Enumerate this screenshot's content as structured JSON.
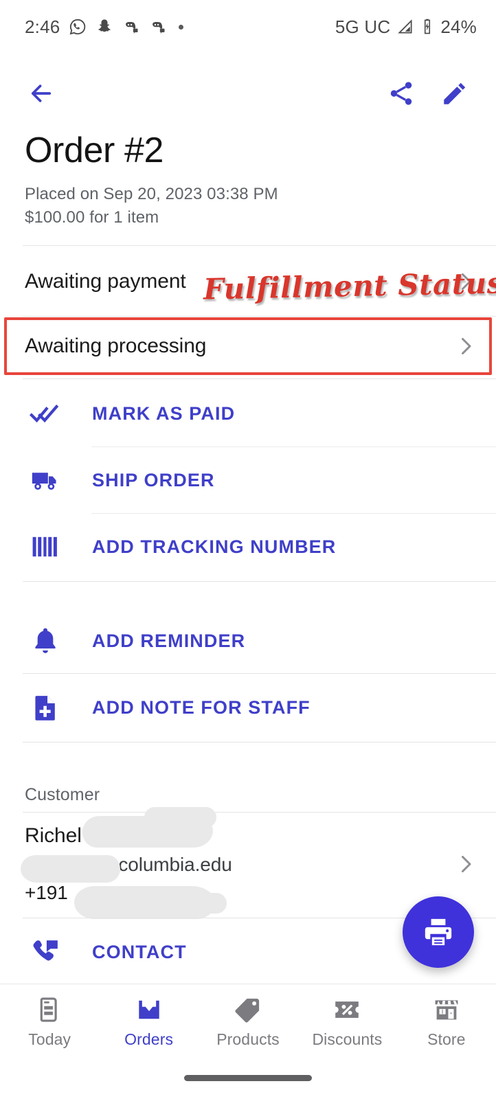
{
  "theme": {
    "accent": "#3f3fc9",
    "fab": "#3f32db",
    "annotation_red": "#d9362c",
    "highlight_red": "#e8453c",
    "text_primary": "#1b1b1b",
    "text_secondary": "#5f6368",
    "divider": "#e4e4e6"
  },
  "statusbar": {
    "time": "2:46",
    "icons": [
      "whatsapp-icon",
      "snapchat-icon",
      "discord-icon",
      "discord-icon",
      "dot-icon"
    ],
    "network": "5G UC",
    "signal_icon": "signal-triangle-icon",
    "battery_icon": "battery-charging-icon",
    "battery": "24%"
  },
  "appbar": {
    "back_icon": "back-arrow-icon",
    "share_icon": "share-icon",
    "edit_icon": "edit-pencil-icon"
  },
  "order": {
    "title": "Order #2",
    "placed": "Placed on Sep 20, 2023 03:38 PM",
    "total": "$100.00 for 1 item"
  },
  "status_rows": [
    {
      "label": "Awaiting payment",
      "chevron_icon": "chevron-right-icon"
    },
    {
      "label": "Awaiting processing",
      "chevron_icon": "chevron-right-icon"
    }
  ],
  "annotation": {
    "text": "Fulfillment Status"
  },
  "actions": [
    {
      "label": "MARK AS PAID",
      "icon": "done-all-icon"
    },
    {
      "label": "SHIP ORDER",
      "icon": "local-shipping-truck-icon"
    },
    {
      "label": "ADD TRACKING NUMBER",
      "icon": "barcode-icon"
    },
    {
      "label": "ADD REMINDER",
      "icon": "bell-icon"
    },
    {
      "label": "ADD NOTE FOR STAFF",
      "icon": "note-add-icon"
    }
  ],
  "customer": {
    "section_label": "Customer",
    "name": "Richel",
    "email": "@columbia.edu",
    "phone": "+191",
    "chevron_icon": "chevron-right-icon",
    "contact": {
      "label": "CONTACT",
      "icon": "phone-message-icon"
    }
  },
  "fab": {
    "icon": "print-icon"
  },
  "bottom_nav": [
    {
      "label": "Today",
      "icon": "today-receipt-icon",
      "active": false
    },
    {
      "label": "Orders",
      "icon": "inbox-download-icon",
      "active": true
    },
    {
      "label": "Products",
      "icon": "tag-icon",
      "active": false
    },
    {
      "label": "Discounts",
      "icon": "ticket-percent-icon",
      "active": false
    },
    {
      "label": "Store",
      "icon": "storefront-icon",
      "active": false
    }
  ]
}
